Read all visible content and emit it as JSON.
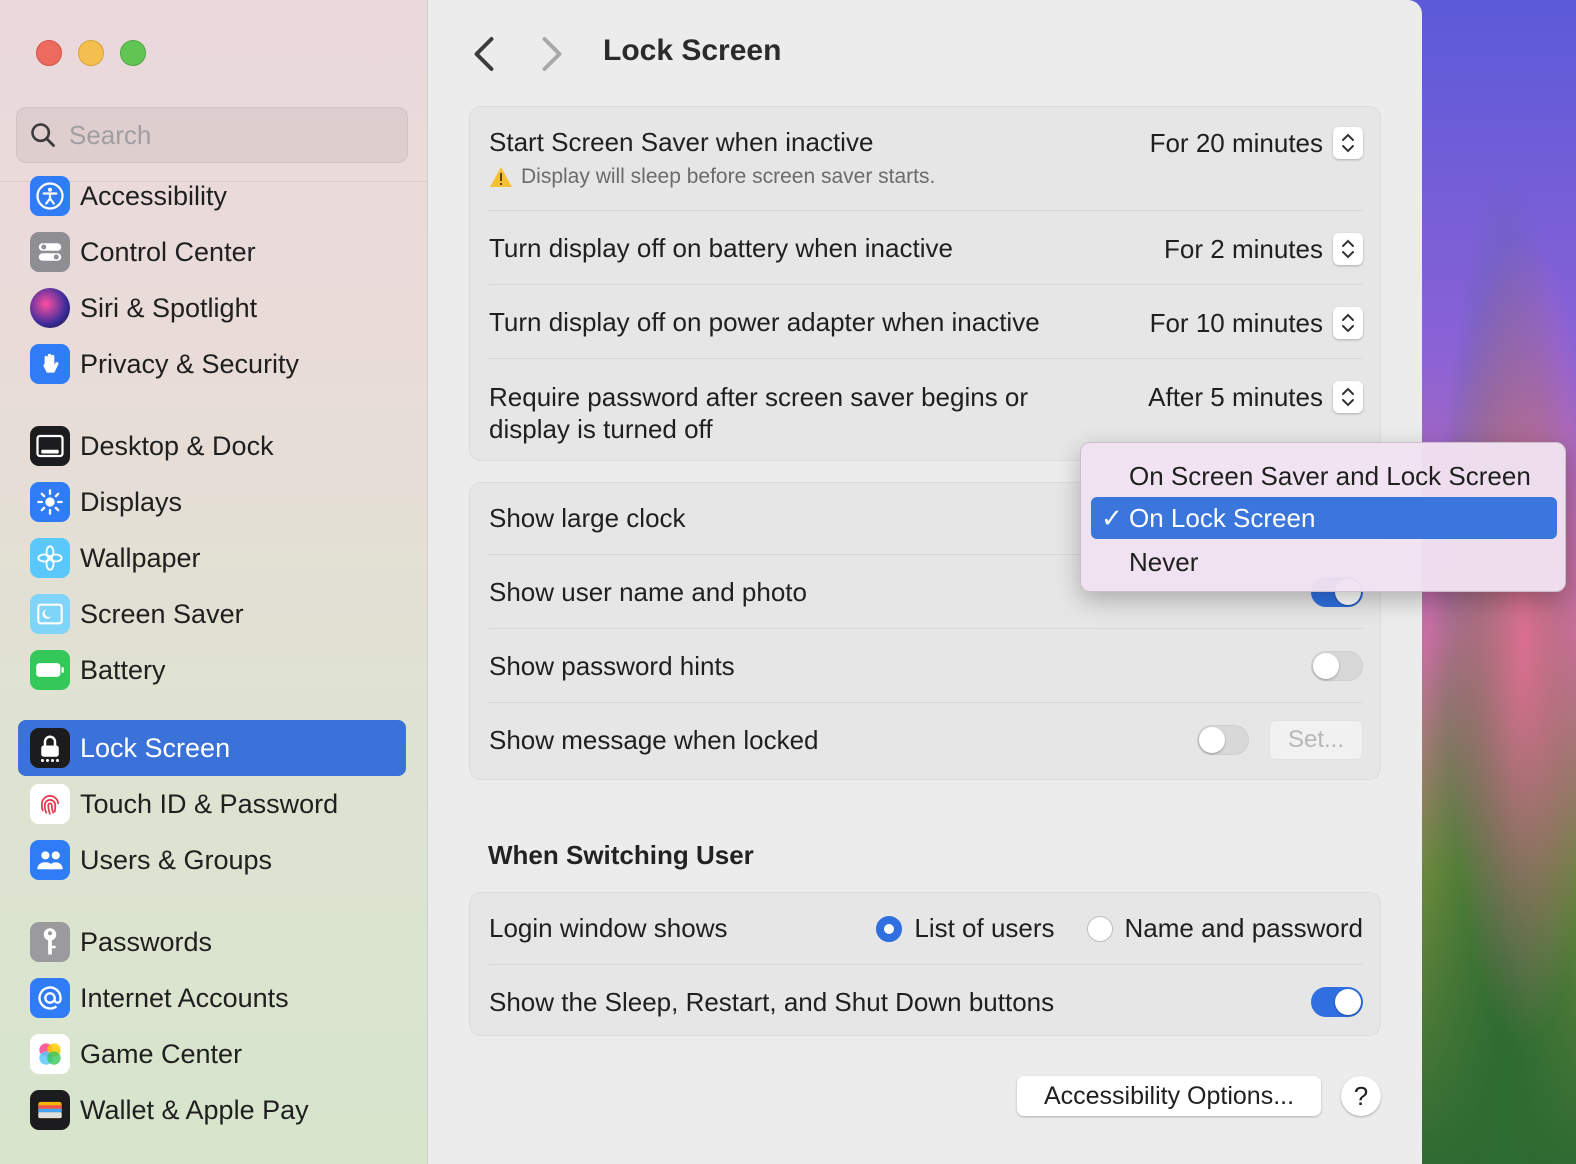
{
  "sidebar": {
    "search_placeholder": "Search",
    "items": [
      {
        "label": "Accessibility",
        "icon": "accessibility-icon",
        "color": "#2f7cf6"
      },
      {
        "label": "Control Center",
        "icon": "control-center-icon",
        "color": "#8e8e93"
      },
      {
        "label": "Siri & Spotlight",
        "icon": "siri-icon",
        "color": "#5a2ea6"
      },
      {
        "label": "Privacy & Security",
        "icon": "hand-icon",
        "color": "#2f7cf6"
      },
      {
        "label": "Desktop & Dock",
        "icon": "desktop-dock-icon",
        "color": "#1c1c1e"
      },
      {
        "label": "Displays",
        "icon": "displays-icon",
        "color": "#2f7cf6"
      },
      {
        "label": "Wallpaper",
        "icon": "wallpaper-icon",
        "color": "#5ac8fa"
      },
      {
        "label": "Screen Saver",
        "icon": "screen-saver-icon",
        "color": "#5ac8fa"
      },
      {
        "label": "Battery",
        "icon": "battery-icon",
        "color": "#34c759"
      },
      {
        "label": "Lock Screen",
        "icon": "lock-icon",
        "color": "#1c1c1e",
        "active": true
      },
      {
        "label": "Touch ID & Password",
        "icon": "fingerprint-icon",
        "color": "#ffffff"
      },
      {
        "label": "Users & Groups",
        "icon": "users-icon",
        "color": "#2f7cf6"
      },
      {
        "label": "Passwords",
        "icon": "key-icon",
        "color": "#8e8e93"
      },
      {
        "label": "Internet Accounts",
        "icon": "at-icon",
        "color": "#2f7cf6"
      },
      {
        "label": "Game Center",
        "icon": "game-center-icon",
        "color": "#ffffff"
      },
      {
        "label": "Wallet & Apple Pay",
        "icon": "wallet-icon",
        "color": "#1c1c1e"
      }
    ]
  },
  "header": {
    "title": "Lock Screen"
  },
  "card1": {
    "screen_saver": {
      "label": "Start Screen Saver when inactive",
      "value": "For 20 minutes",
      "warning": "Display will sleep before screen saver starts."
    },
    "battery": {
      "label": "Turn display off on battery when inactive",
      "value": "For 2 minutes"
    },
    "adapter": {
      "label": "Turn display off on power adapter when inactive",
      "value": "For 10 minutes"
    },
    "password": {
      "label_line1": "Require password after screen saver begins or",
      "label_line2": "display is turned off",
      "value": "After 5 minutes"
    }
  },
  "card2": {
    "large_clock": {
      "label": "Show large clock"
    },
    "user_name": {
      "label": "Show user name and photo",
      "on": true
    },
    "hints": {
      "label": "Show password hints",
      "on": false
    },
    "message": {
      "label": "Show message when locked",
      "on": false,
      "button": "Set..."
    }
  },
  "switching": {
    "heading": "When Switching User",
    "login_window": {
      "label": "Login window shows",
      "options": [
        "List of users",
        "Name and password"
      ],
      "selected": "List of users"
    },
    "sleep_buttons": {
      "label": "Show the Sleep, Restart, and Shut Down buttons",
      "on": true
    }
  },
  "footer": {
    "accessibility_button": "Accessibility Options...",
    "help": "?"
  },
  "dropdown": {
    "options": [
      "On Screen Saver and Lock Screen",
      "On Lock Screen",
      "Never"
    ],
    "selected": "On Lock Screen",
    "check": "✓"
  },
  "colors": {
    "accent": "#3a72d9",
    "toggle_on": "#2f6fe0"
  }
}
